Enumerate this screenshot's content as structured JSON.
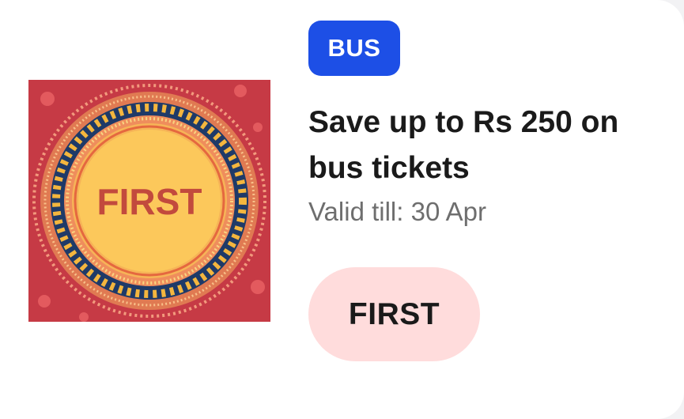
{
  "offer": {
    "category_badge": "BUS",
    "title": "Save up to Rs 250 on bus tickets",
    "validity": "Valid till: 30 Apr",
    "coupon_code": "FIRST",
    "image_text": "FIRST"
  },
  "colors": {
    "badge_bg": "#1d4fe6",
    "coupon_bg": "#ffdcdc",
    "image_bg": "#c63a45",
    "image_center": "#fcc85b",
    "image_text": "#c24a3d",
    "ring_navy": "#1f3a68"
  },
  "icons": {
    "offer_image": "decorative-mandala-coupon-art"
  }
}
